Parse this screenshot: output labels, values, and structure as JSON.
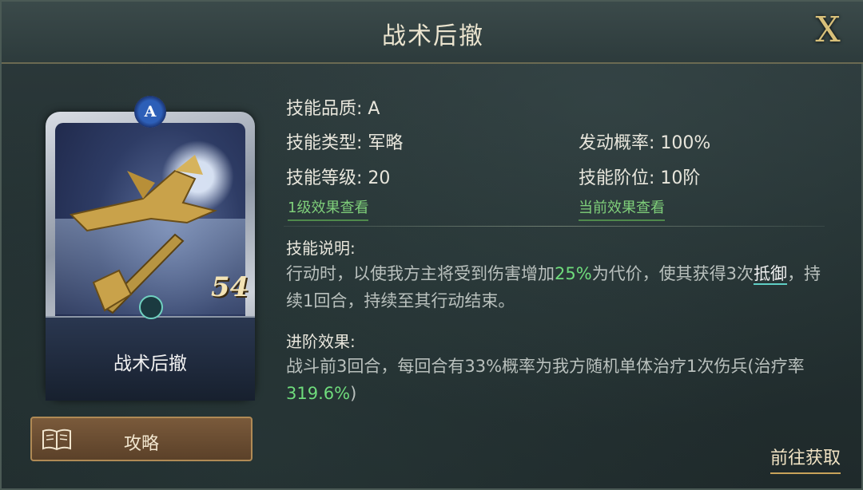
{
  "window": {
    "title": "战术后撤",
    "close_label": "X"
  },
  "card": {
    "name": "战术后撤",
    "quality_gem": "A",
    "level_badge": "54"
  },
  "guide_button": {
    "label": "攻略",
    "icon": "book-icon"
  },
  "info": {
    "quality": "技能品质: A",
    "type": "技能类型: 军略",
    "rate": "发动概率: 100%",
    "level": "技能等级: 20",
    "rank": "技能阶位: 10阶",
    "link_lv1": "1级效果查看",
    "link_current": "当前效果查看"
  },
  "description": {
    "title": "技能说明:",
    "part1": "行动时，以使我方主将受到伤害增加",
    "highlight1": "25%",
    "part2": "为代价，使其获得3次",
    "keyword": "抵御",
    "part3": "，持续1回合，持续至其行动结束。"
  },
  "advance": {
    "title": "进阶效果:",
    "part1": "战斗前3回合，每回合有33%概率为我方随机单体治疗1次伤兵(治疗率",
    "highlight": "319.6%",
    "part2": ")"
  },
  "goto_button": {
    "label": "前往获取"
  },
  "colors": {
    "highlight": "#6fdc7c",
    "link": "#7fcf7a",
    "accent_gold": "#c8a35a"
  }
}
